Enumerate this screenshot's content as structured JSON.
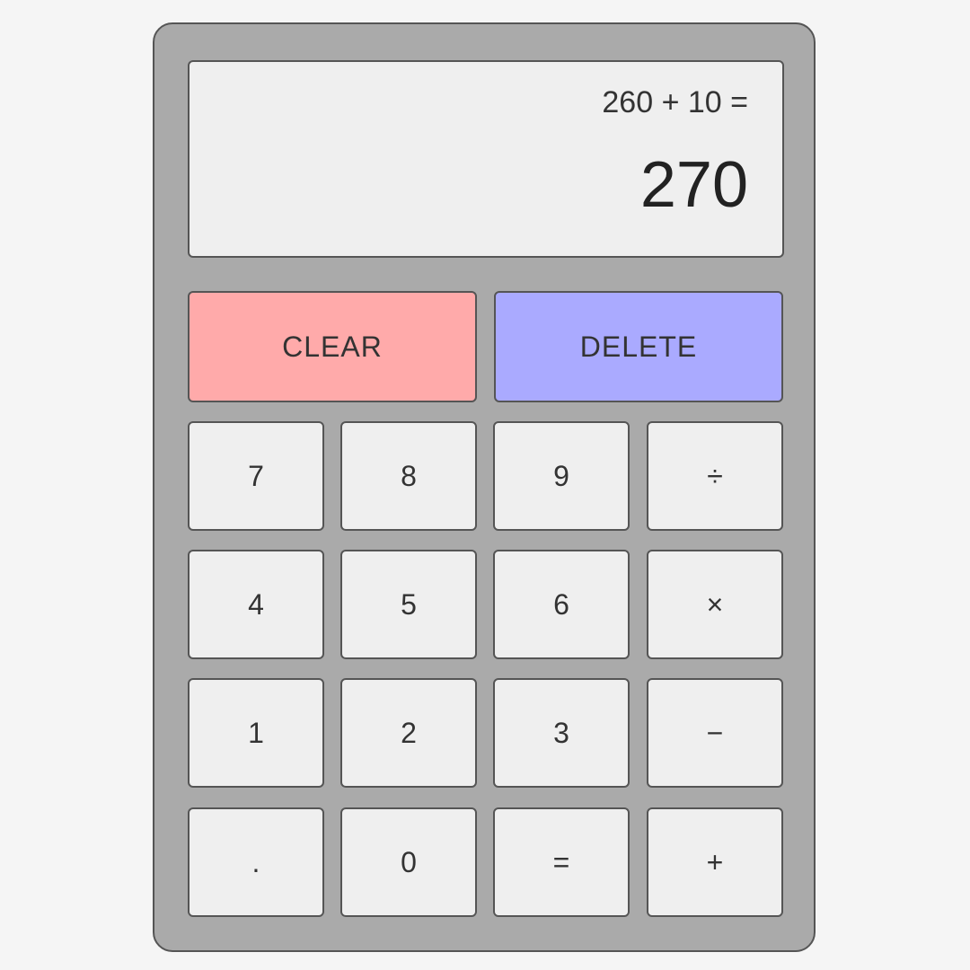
{
  "display": {
    "expression": "260 + 10 =",
    "result": "270"
  },
  "actions": {
    "clear": {
      "label": "CLEAR",
      "color": "#ffaaaa"
    },
    "delete": {
      "label": "DELETE",
      "color": "#aaaaff"
    }
  },
  "keys": [
    [
      "7",
      "8",
      "9",
      "÷"
    ],
    [
      "4",
      "5",
      "6",
      "×"
    ],
    [
      "1",
      "2",
      "3",
      "−"
    ],
    [
      ".",
      "0",
      "=",
      "+"
    ]
  ],
  "key_names": [
    [
      "key-7",
      "key-8",
      "key-9",
      "key-divide"
    ],
    [
      "key-4",
      "key-5",
      "key-6",
      "key-multiply"
    ],
    [
      "key-1",
      "key-2",
      "key-3",
      "key-subtract"
    ],
    [
      "key-decimal",
      "key-0",
      "key-equals",
      "key-add"
    ]
  ],
  "colors": {
    "body": "#aaaaaa",
    "key": "#efefef",
    "page": "#f5f5f5"
  }
}
